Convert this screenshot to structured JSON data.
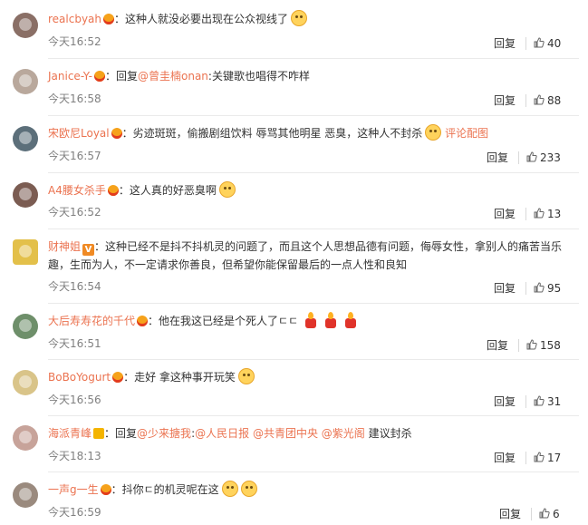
{
  "comments": [
    {
      "user": "realcbyah",
      "text": "这种人就没必要出现在公众视线了",
      "time": "今天16:52",
      "reply": "回复",
      "likes": "40"
    },
    {
      "user": "Janice-Y-",
      "reply_prefix": "回复",
      "mention": "@曾圭楠onan",
      "text": ":关键歌也唱得不咋样",
      "time": "今天16:58",
      "reply": "回复",
      "likes": "88"
    },
    {
      "user": "宋欧尼Loyal",
      "text": "劣迹斑斑，偷搬剧组饮料 辱骂其他明星 恶臭，这种人不封杀",
      "link": "评论配图",
      "time": "今天16:57",
      "reply": "回复",
      "likes": "233"
    },
    {
      "user": "A4腰女杀手",
      "text": "这人真的好恶臭啊",
      "time": "今天16:52",
      "reply": "回复",
      "likes": "13"
    },
    {
      "user": "财神姐",
      "text": "这种已经不是抖不抖机灵的问题了，而且这个人思想品德有问题，侮辱女性，拿别人的痛苦当乐趣，生而为人，不一定请求你善良，但希望你能保留最后的一点人性和良知",
      "time": "今天16:54",
      "reply": "回复",
      "likes": "95"
    },
    {
      "user": "大后寿寿花的千代",
      "text": "他在我这已经是个死人了ㄷㄷ",
      "time": "今天16:51",
      "reply": "回复",
      "likes": "158"
    },
    {
      "user": "BoBoYogurt",
      "text": "走好 拿这种事开玩笑",
      "time": "今天16:56",
      "reply": "回复",
      "likes": "31"
    },
    {
      "user": "海派青峰",
      "reply_prefix": "回复",
      "mention": "@少来搪我",
      "mentions_extra": [
        ":",
        "@人民日报",
        "@共青团中央",
        "@紫光阁"
      ],
      "text": "建议封杀",
      "time": "今天18:13",
      "reply": "回复",
      "likes": "17"
    },
    {
      "user": "一声g一生",
      "text": "抖你ㄷ的机灵呢在这",
      "time": "今天16:59",
      "reply": "回复",
      "likes": "6"
    }
  ],
  "colors": {
    "username": "#eb7350",
    "time": "#808080",
    "divider": "#eaeaea"
  },
  "icons": {
    "badge": "crown-badge-icon",
    "vip": "v-badge-icon",
    "like": "thumbs-up-icon",
    "emoji": "emoji-icon",
    "candle": "candle-icon"
  }
}
